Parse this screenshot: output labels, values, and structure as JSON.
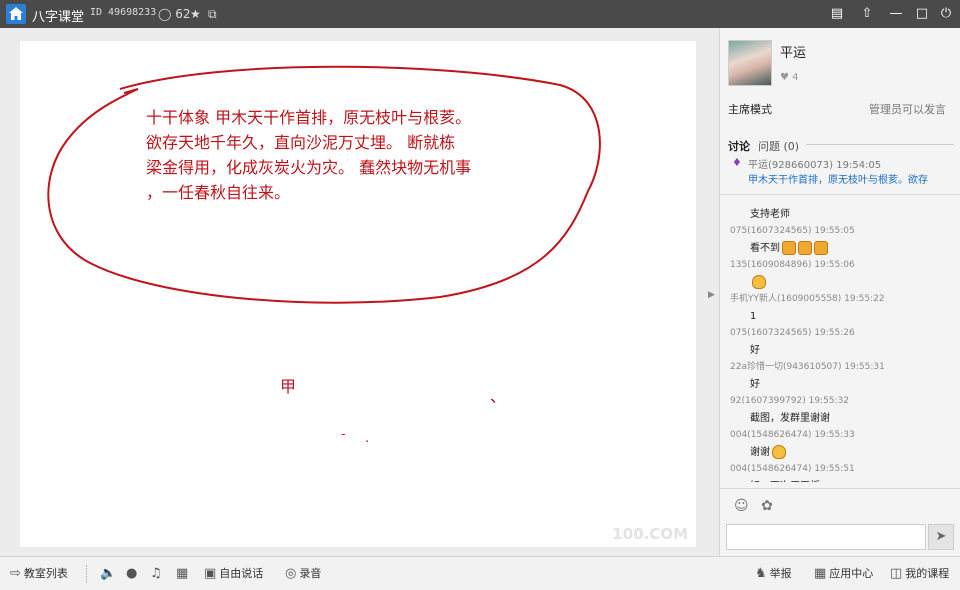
{
  "titlebar": {
    "app_name": "八字课堂",
    "room_id": "ID 49698233",
    "online_count": "62",
    "icons": [
      "home-icon",
      "user-icon",
      "star-icon",
      "share-icon",
      "menu-icon",
      "skin-icon",
      "minimize-icon",
      "maximize-icon",
      "power-icon"
    ]
  },
  "board": {
    "poem_lines": [
      "十干体象  甲木天干作首排，原无枝叶与根荄。",
      "  欲存天地千年久，直向沙泥万丈埋。 断就栋",
      "梁金得用，化成灰炭火为灾。 蠢然块物无机事",
      "，一任春秋自往来。"
    ],
    "loose_char": "甲",
    "mark_1": "、",
    "mark_2": "-",
    "mark_3": ".",
    "watermark": "100.COM",
    "ink_color": "#c0131a"
  },
  "panel": {
    "teacher_name": "平运",
    "likes": "4",
    "mode_label": "主席模式",
    "permission_note": "管理员可以发言",
    "tab_discuss": "讨论",
    "tab_question": "问题",
    "question_count": "(0)",
    "pinned_meta": "平运(928660073) 19:54:05",
    "pinned_message": "甲木天干作首排，原无枝叶与根荄。欲存",
    "chat": [
      {
        "kind": "text",
        "value": "支持老师"
      },
      {
        "kind": "meta",
        "value": "075(1607324565) 19:55:05"
      },
      {
        "kind": "text",
        "value": "看不到",
        "emoji": 3
      },
      {
        "kind": "meta",
        "value": "135(1609084896) 19:55:06"
      },
      {
        "kind": "text",
        "value": "",
        "emoji": 1,
        "hand": true
      },
      {
        "kind": "meta",
        "value": "手机YY新人(1609005558) 19:55:22"
      },
      {
        "kind": "text",
        "value": "1"
      },
      {
        "kind": "meta",
        "value": "075(1607324565) 19:55:26"
      },
      {
        "kind": "text",
        "value": "好"
      },
      {
        "kind": "meta",
        "value": "22a珍惜一切(943610507) 19:55:31"
      },
      {
        "kind": "text",
        "value": "好"
      },
      {
        "kind": "meta",
        "value": "92(1607399792) 19:55:32"
      },
      {
        "kind": "text",
        "value": "截图，发群里谢谢"
      },
      {
        "kind": "meta",
        "value": "004(1548626474) 19:55:33"
      },
      {
        "kind": "text",
        "value": "谢谢",
        "emoji": 1,
        "hand": true
      },
      {
        "kind": "meta",
        "value": "004(1548626474) 19:55:51"
      },
      {
        "kind": "text",
        "value": "好，下次用平板"
      }
    ],
    "send_icon": "send-icon"
  },
  "bottombar": {
    "class_list": "教室列表",
    "free_talk": "自由说话",
    "record": "录音",
    "report": "举报",
    "app_center": "应用中心",
    "my_courses": "我的课程"
  }
}
